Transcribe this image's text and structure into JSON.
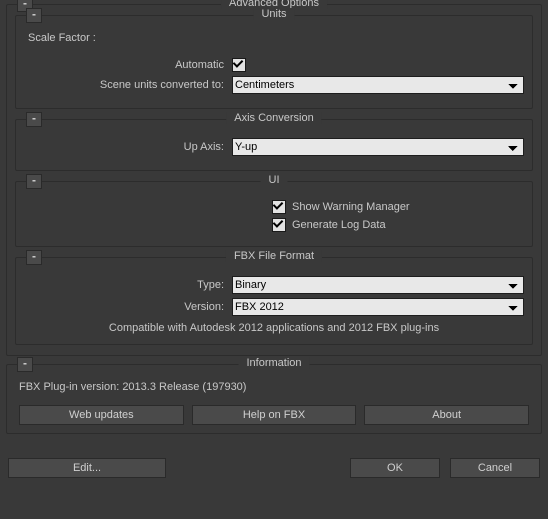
{
  "advanced": {
    "title": "Advanced Options",
    "collapse": "-",
    "units": {
      "title": "Units",
      "collapse": "-",
      "scale_factor_label": "Scale Factor :",
      "automatic_label": "Automatic",
      "automatic_checked": true,
      "scene_units_label": "Scene units converted to:",
      "scene_units_value": "Centimeters"
    },
    "axis": {
      "title": "Axis Conversion",
      "collapse": "-",
      "up_axis_label": "Up Axis:",
      "up_axis_value": "Y-up"
    },
    "ui": {
      "title": "UI",
      "collapse": "-",
      "show_warning_label": "Show Warning Manager",
      "show_warning_checked": true,
      "generate_log_label": "Generate Log Data",
      "generate_log_checked": true
    },
    "fbx": {
      "title": "FBX File Format",
      "collapse": "-",
      "type_label": "Type:",
      "type_value": "Binary",
      "version_label": "Version:",
      "version_value": "FBX 2012",
      "compat_text": "Compatible with Autodesk 2012 applications and 2012 FBX plug-ins"
    }
  },
  "information": {
    "title": "Information",
    "collapse": "-",
    "version_text": "FBX Plug-in version: 2013.3 Release (197930)",
    "web_updates": "Web updates",
    "help": "Help on FBX",
    "about": "About"
  },
  "footer": {
    "edit": "Edit...",
    "ok": "OK",
    "cancel": "Cancel"
  }
}
